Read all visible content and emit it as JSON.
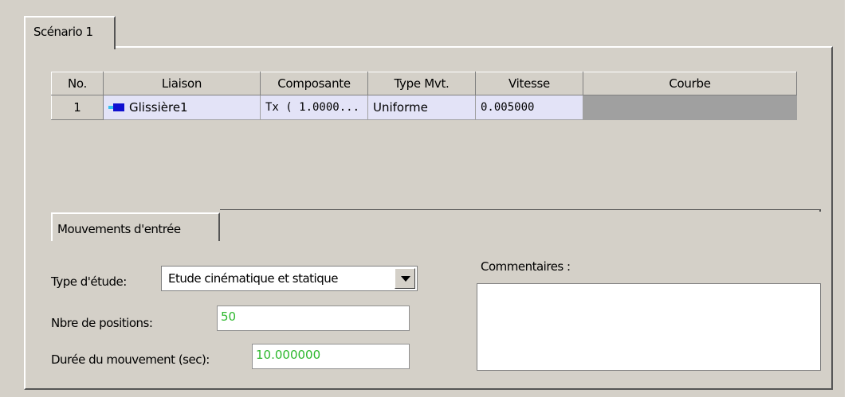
{
  "tabs": {
    "scenario": "Scénario 1",
    "sub": "Mouvements d'entrée"
  },
  "table": {
    "headers": [
      "No.",
      "Liaison",
      "Composante",
      "Type Mvt.",
      "Vitesse",
      "Courbe"
    ],
    "rows": [
      {
        "no": "1",
        "liaison": "Glissière1",
        "composante": "Tx ( 1.0000...",
        "type": "Uniforme",
        "vitesse": "0.005000",
        "courbe": ""
      }
    ]
  },
  "form": {
    "type_label": "Type d'étude:",
    "type_value": "Etude cinématique et statique",
    "positions_label": "Nbre de positions:",
    "positions_value": "50",
    "duree_label": "Durée du mouvement (sec):",
    "duree_value": "10.000000",
    "comment_label": "Commentaires :",
    "comment_value": ""
  },
  "icons": {
    "liaison": "slider-joint-icon",
    "dropdown": "chevron-down-icon"
  },
  "colors": {
    "window": "#d4d0c8",
    "row_selected": "#e3e3f7",
    "value_text": "#2db82d"
  }
}
